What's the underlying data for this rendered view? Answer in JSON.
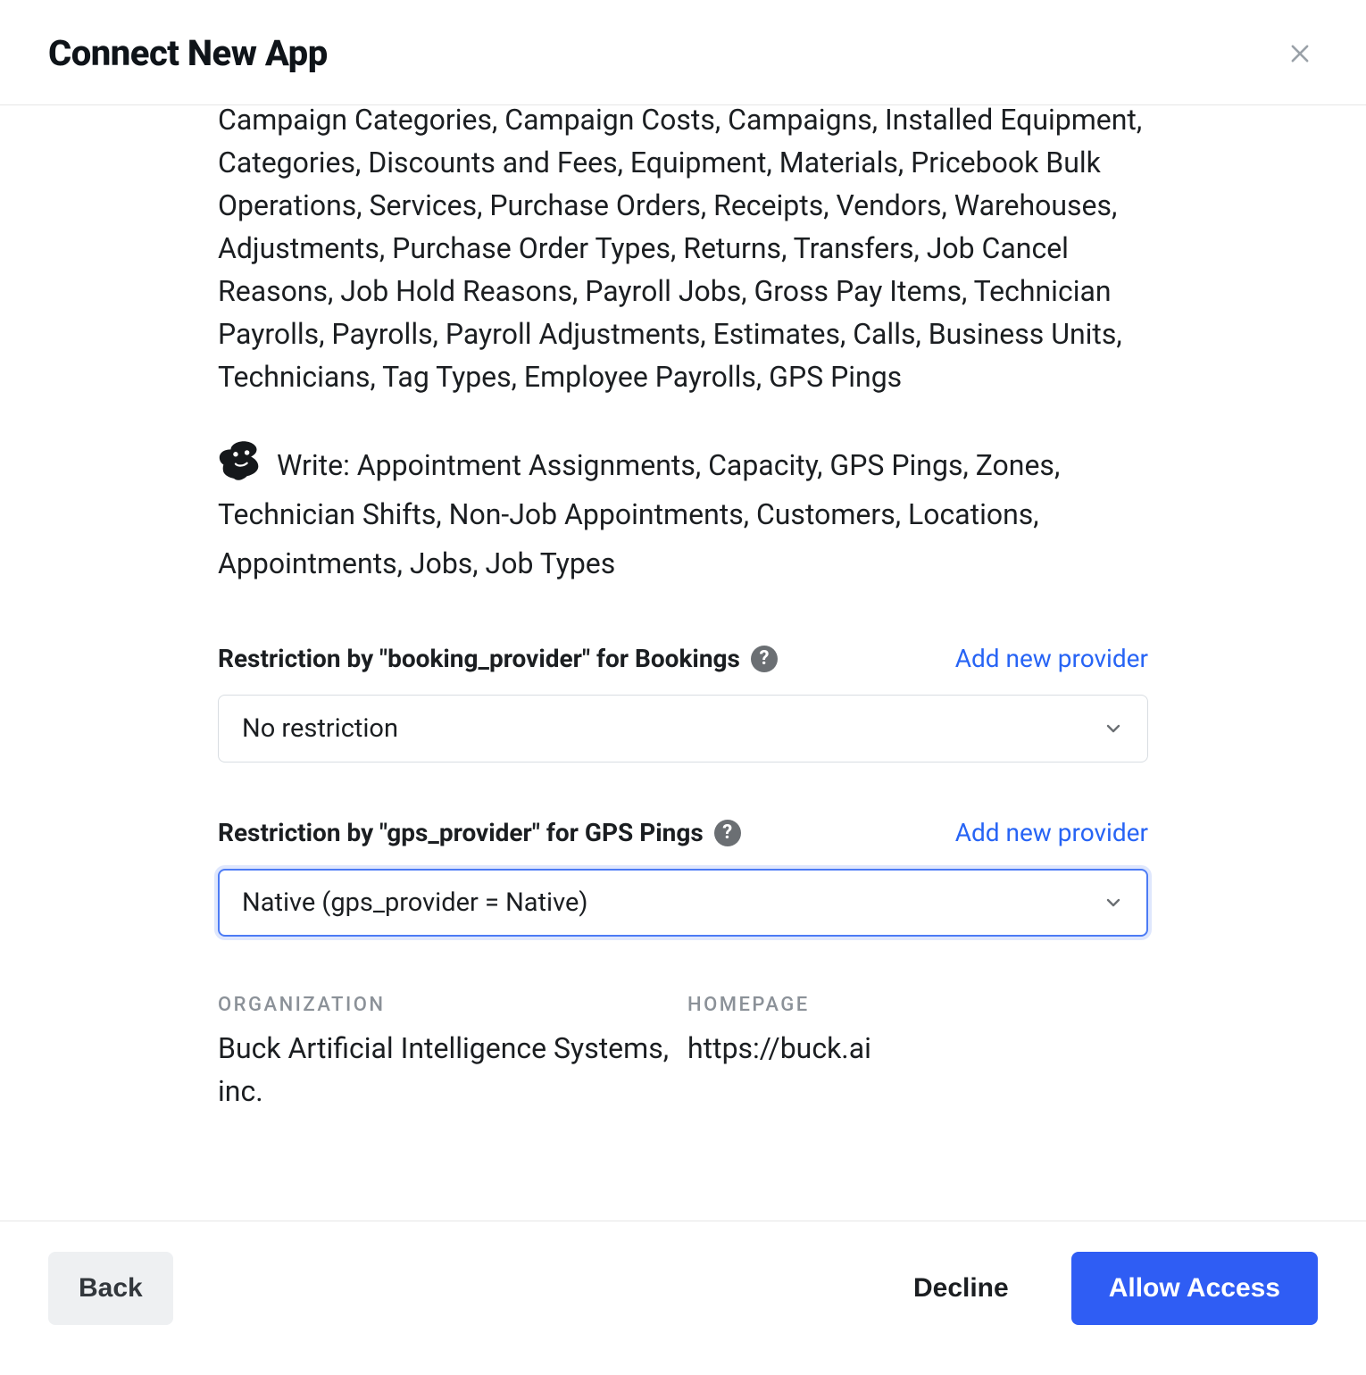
{
  "header": {
    "title": "Connect New App"
  },
  "permissions": {
    "read_fragment": "Campaign Categories, Campaign Costs, Campaigns, Installed Equipment, Categories, Discounts and Fees, Equipment, Materials, Pricebook Bulk Operations, Services, Purchase Orders, Receipts, Vendors, Warehouses, Adjustments, Purchase Order Types, Returns, Transfers, Job Cancel Reasons, Job Hold Reasons, Payroll Jobs, Gross Pay Items, Technician Payrolls, Payrolls, Payroll Adjustments, Estimates, Calls, Business Units, Technicians, Tag Types, Employee Payrolls, GPS Pings",
    "write_label": "Write:",
    "write_list": "Appointment Assignments, Capacity, GPS Pings, Zones, Technician Shifts, Non-Job Appointments, Customers, Locations, Appointments, Jobs, Job Types"
  },
  "restrictions": {
    "booking": {
      "label": "Restriction by \"booking_provider\" for Bookings",
      "add_link": "Add new provider",
      "selected": "No restriction"
    },
    "gps": {
      "label": "Restriction by \"gps_provider\" for GPS Pings",
      "add_link": "Add new provider",
      "selected": "Native (gps_provider = Native)"
    }
  },
  "info": {
    "org_label": "ORGANIZATION",
    "org_value": "Buck Artificial Intelligence Systems, inc.",
    "home_label": "HOMEPAGE",
    "home_value": "https://buck.ai"
  },
  "footer": {
    "back": "Back",
    "decline": "Decline",
    "allow": "Allow Access"
  }
}
